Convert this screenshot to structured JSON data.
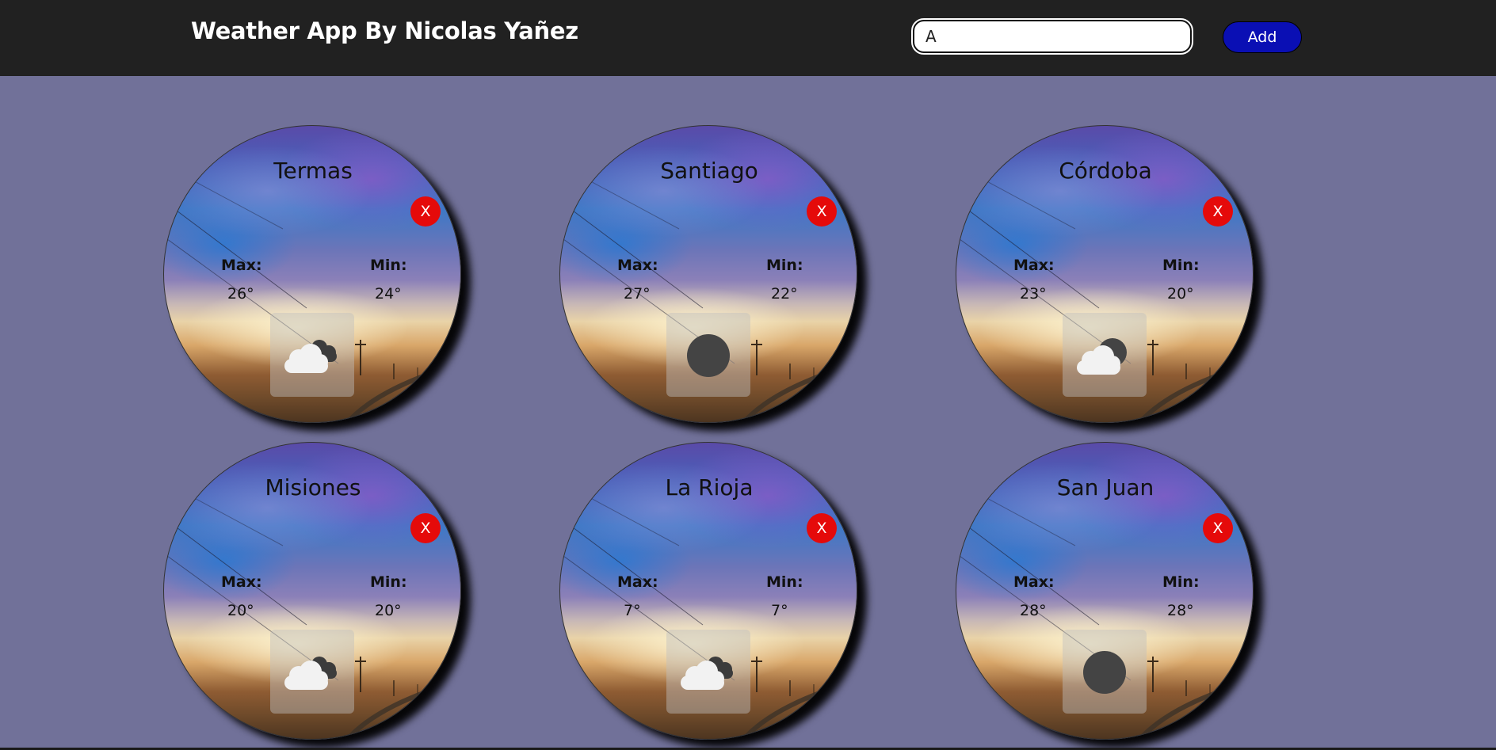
{
  "header": {
    "title": "Weather App By Nicolas Yañez",
    "search_value": "A",
    "add_label": "Add"
  },
  "cards": [
    {
      "city": "Termas",
      "close_label": "X",
      "max_label": "Max:",
      "max": "26°",
      "min_label": "Min:",
      "min": "24°",
      "icon": "broken-clouds-icon"
    },
    {
      "city": "Santiago",
      "close_label": "X",
      "max_label": "Max:",
      "max": "27°",
      "min_label": "Min:",
      "min": "22°",
      "icon": "clear-sky-icon"
    },
    {
      "city": "Córdoba",
      "close_label": "X",
      "max_label": "Max:",
      "max": "23°",
      "min_label": "Min:",
      "min": "20°",
      "icon": "few-clouds-icon"
    },
    {
      "city": "Misiones",
      "close_label": "X",
      "max_label": "Max:",
      "max": "20°",
      "min_label": "Min:",
      "min": "20°",
      "icon": "broken-clouds-icon"
    },
    {
      "city": "La Rioja",
      "close_label": "X",
      "max_label": "Max:",
      "max": "7°",
      "min_label": "Min:",
      "min": "7°",
      "icon": "broken-clouds-icon"
    },
    {
      "city": "San Juan",
      "close_label": "X",
      "max_label": "Max:",
      "max": "28°",
      "min_label": "Min:",
      "min": "28°",
      "icon": "clear-sky-icon"
    }
  ],
  "colors": {
    "navbar": "#212121",
    "background": "#717199",
    "add_button": "#0a0fb4",
    "close_button": "#e50a0a"
  }
}
